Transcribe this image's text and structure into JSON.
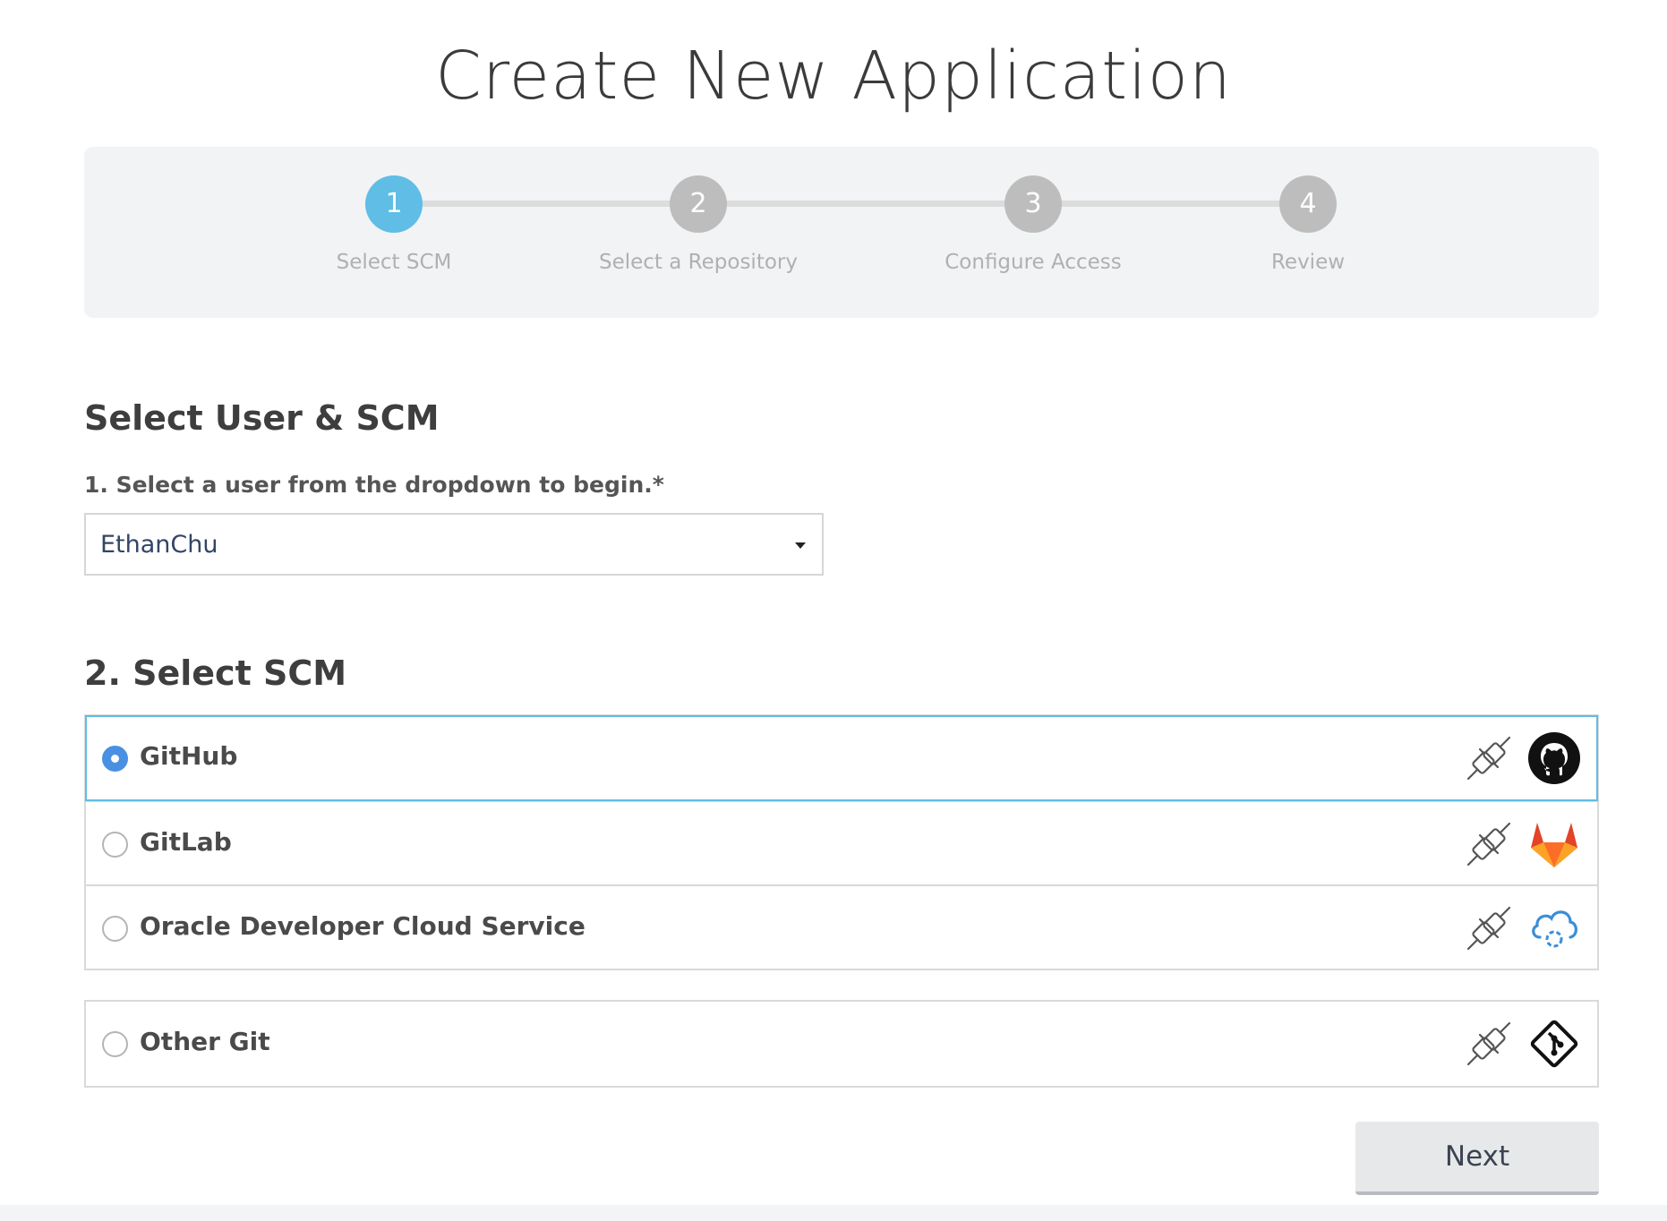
{
  "page_title": "Create New Application",
  "wizard": {
    "steps": [
      {
        "number": "1",
        "label": "Select SCM",
        "active": true
      },
      {
        "number": "2",
        "label": "Select a Repository",
        "active": false
      },
      {
        "number": "3",
        "label": "Configure Access",
        "active": false
      },
      {
        "number": "4",
        "label": "Review",
        "active": false
      }
    ]
  },
  "user_section": {
    "title": "Select User & SCM",
    "label": "1. Select a user from the dropdown to begin.*",
    "selected_user": "EthanChu"
  },
  "scm_section": {
    "title": "2. Select SCM",
    "options": [
      {
        "label": "GitHub",
        "selected": true,
        "icon": "github-icon"
      },
      {
        "label": "GitLab",
        "selected": false,
        "icon": "gitlab-icon"
      },
      {
        "label": "Oracle Developer Cloud Service",
        "selected": false,
        "icon": "oracle-cloud-icon"
      },
      {
        "label": "Other Git",
        "selected": false,
        "icon": "git-icon"
      }
    ]
  },
  "next_label": "Next",
  "colors": {
    "accent": "#5fbde6",
    "radio_selected": "#4a90e2",
    "inactive_step": "#bdbdbd"
  }
}
